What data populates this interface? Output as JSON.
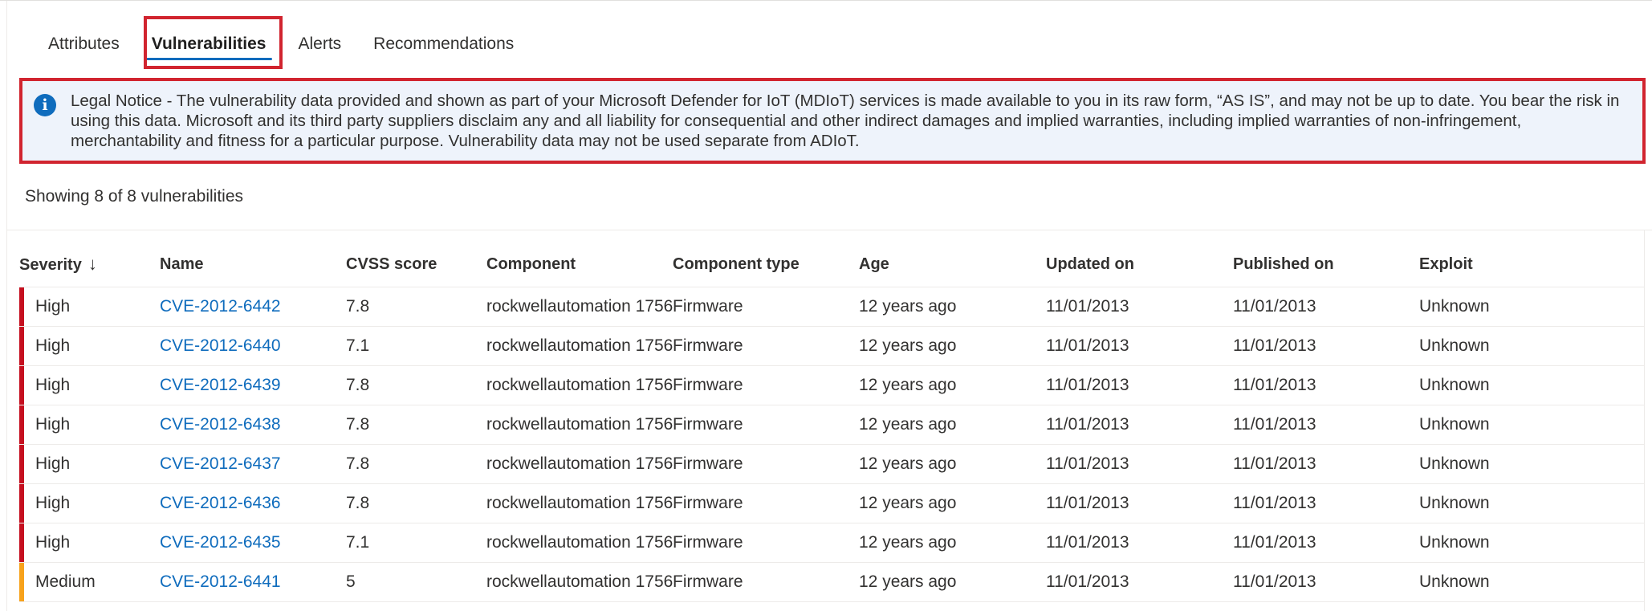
{
  "tabs": [
    {
      "label": "Attributes",
      "active": false
    },
    {
      "label": "Vulnerabilities",
      "active": true
    },
    {
      "label": "Alerts",
      "active": false
    },
    {
      "label": "Recommendations",
      "active": false
    }
  ],
  "notice": {
    "icon": "info-icon",
    "text": "Legal Notice - The vulnerability data provided and shown as part of your Microsoft Defender for IoT (MDIoT) services is made available to you in its raw form, “AS IS”, and may not be up to date. You bear the risk in using this data. Microsoft and its third party suppliers disclaim any and all liability for consequential and other indirect damages and implied warranties, including implied warranties of non-infringement, merchantability and fitness for a particular purpose. Vulnerability data may not be used separate from ADIoT."
  },
  "summary": "Showing 8 of 8 vulnerabilities",
  "table": {
    "headers": {
      "severity": "Severity",
      "sort_icon": "↓",
      "name": "Name",
      "cvss": "CVSS score",
      "component": "Component",
      "component_type": "Component type",
      "age": "Age",
      "updated": "Updated on",
      "published": "Published on",
      "exploit": "Exploit"
    },
    "severity_colors": {
      "High": "#c50f1f",
      "Medium": "#f7a21b"
    },
    "rows": [
      {
        "severity": "High",
        "name": "CVE-2012-6442",
        "cvss": "7.8",
        "component": "rockwellautomation 1756",
        "component_type": "Firmware",
        "age": "12 years ago",
        "updated": "11/01/2013",
        "published": "11/01/2013",
        "exploit": "Unknown"
      },
      {
        "severity": "High",
        "name": "CVE-2012-6440",
        "cvss": "7.1",
        "component": "rockwellautomation 1756",
        "component_type": "Firmware",
        "age": "12 years ago",
        "updated": "11/01/2013",
        "published": "11/01/2013",
        "exploit": "Unknown"
      },
      {
        "severity": "High",
        "name": "CVE-2012-6439",
        "cvss": "7.8",
        "component": "rockwellautomation 1756",
        "component_type": "Firmware",
        "age": "12 years ago",
        "updated": "11/01/2013",
        "published": "11/01/2013",
        "exploit": "Unknown"
      },
      {
        "severity": "High",
        "name": "CVE-2012-6438",
        "cvss": "7.8",
        "component": "rockwellautomation 1756",
        "component_type": "Firmware",
        "age": "12 years ago",
        "updated": "11/01/2013",
        "published": "11/01/2013",
        "exploit": "Unknown"
      },
      {
        "severity": "High",
        "name": "CVE-2012-6437",
        "cvss": "7.8",
        "component": "rockwellautomation 1756",
        "component_type": "Firmware",
        "age": "12 years ago",
        "updated": "11/01/2013",
        "published": "11/01/2013",
        "exploit": "Unknown"
      },
      {
        "severity": "High",
        "name": "CVE-2012-6436",
        "cvss": "7.8",
        "component": "rockwellautomation 1756",
        "component_type": "Firmware",
        "age": "12 years ago",
        "updated": "11/01/2013",
        "published": "11/01/2013",
        "exploit": "Unknown"
      },
      {
        "severity": "High",
        "name": "CVE-2012-6435",
        "cvss": "7.1",
        "component": "rockwellautomation 1756",
        "component_type": "Firmware",
        "age": "12 years ago",
        "updated": "11/01/2013",
        "published": "11/01/2013",
        "exploit": "Unknown"
      },
      {
        "severity": "Medium",
        "name": "CVE-2012-6441",
        "cvss": "5",
        "component": "rockwellautomation 1756",
        "component_type": "Firmware",
        "age": "12 years ago",
        "updated": "11/01/2013",
        "published": "11/01/2013",
        "exploit": "Unknown"
      }
    ]
  },
  "highlight_color": "#d1242f",
  "accent_color": "#0f6cbd"
}
